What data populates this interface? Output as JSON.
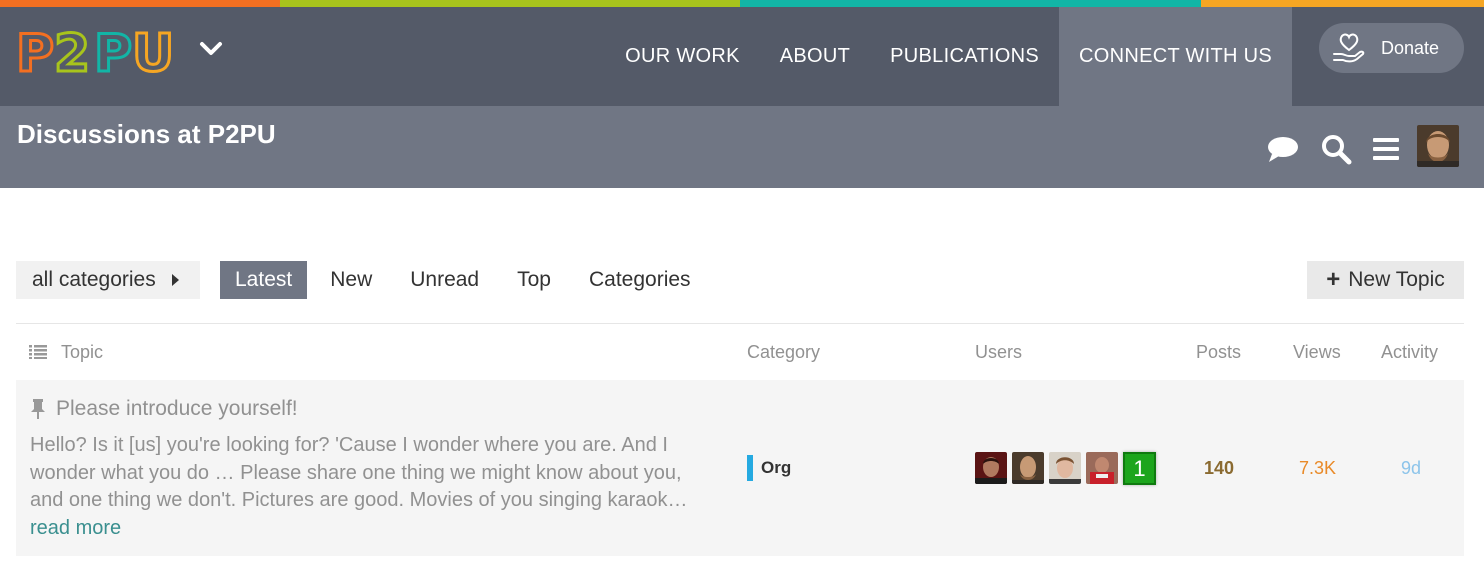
{
  "colors": {
    "bar": [
      "#f36f21",
      "#a8c41c",
      "#12b5a6",
      "#f6a623"
    ],
    "nav_bg": "#545a68",
    "sub_bg": "#707684",
    "category_org": "#25aae1",
    "user_count_badge": "#1ca51c"
  },
  "nav": {
    "logo_text": "P2PU",
    "links": [
      "OUR WORK",
      "ABOUT",
      "PUBLICATIONS",
      "CONNECT WITH US"
    ],
    "active_link": "CONNECT WITH US",
    "donate_label": "Donate"
  },
  "header": {
    "title": "Discussions at P2PU",
    "icons": [
      "chat-bubble-icon",
      "search-icon",
      "hamburger-menu-icon",
      "user-avatar"
    ]
  },
  "filters": {
    "category_dropdown": "all categories",
    "tabs": [
      "Latest",
      "New",
      "Unread",
      "Top",
      "Categories"
    ],
    "active_tab": "Latest",
    "new_topic_label": "New Topic"
  },
  "table": {
    "columns": {
      "topic": "Topic",
      "category": "Category",
      "users": "Users",
      "posts": "Posts",
      "views": "Views",
      "activity": "Activity"
    },
    "rows": [
      {
        "pinned": true,
        "title": "Please introduce yourself!",
        "excerpt": "Hello? Is it [us] you're looking for? 'Cause I wonder where you are. And I wonder what you do … Please share one thing we might know about you, and one thing we don't. Pictures are good. Movies of you singing karaok…",
        "read_more": "read more",
        "category": "Org",
        "extra_users": "1",
        "posts": "140",
        "views": "7.3K",
        "activity": "9d"
      }
    ]
  }
}
